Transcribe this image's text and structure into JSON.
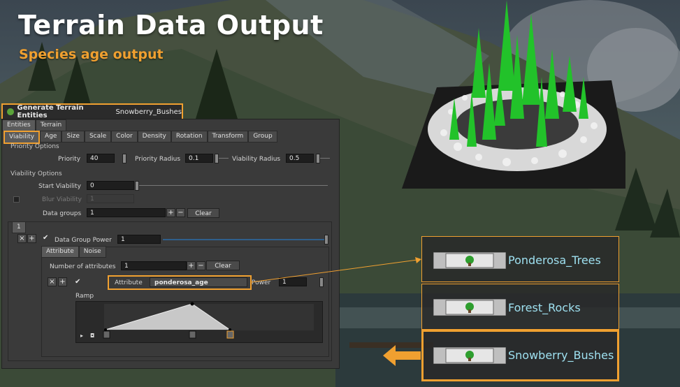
{
  "slide": {
    "title": "Terrain Data Output",
    "subtitle": "Species age output"
  },
  "header": {
    "title": "Generate Terrain Entities",
    "node_name": "Snowberry_Bushes"
  },
  "top_tabs": [
    "Entities",
    "Terrain"
  ],
  "tabs": [
    "Viability",
    "Age",
    "Size",
    "Scale",
    "Color",
    "Density",
    "Rotation",
    "Transform",
    "Group"
  ],
  "priority": {
    "section": "Priority Options",
    "priority_label": "Priority",
    "priority_value": "40",
    "radius_label": "Priority Radius",
    "radius_value": "0.1",
    "viability_radius_label": "Viability Radius",
    "viability_radius_value": "0.5"
  },
  "viability": {
    "section": "Viability Options",
    "start_label": "Start Viability",
    "start_value": "0",
    "blur_label": "Blur Viability",
    "blur_value": "1",
    "groups_label": "Data groups",
    "groups_value": "1",
    "clear": "Clear",
    "group_index": "1"
  },
  "data_group": {
    "power_label": "Data Group Power",
    "power_value": "1",
    "subtabs": [
      "Attribute",
      "Noise"
    ],
    "num_attr_label": "Number of attributes",
    "num_attr_value": "1",
    "clear": "Clear",
    "attribute_label": "Attribute",
    "attribute_value": "ponderosa_age",
    "attr_power_label": "Power",
    "attr_power_value": "1",
    "ramp_label": "Ramp"
  },
  "nodes": [
    {
      "label": "Ponderosa_Trees"
    },
    {
      "label": "Forest_Rocks"
    },
    {
      "label": "Snowberry_Bushes"
    }
  ],
  "colors": {
    "accent": "#f0a030",
    "node_text": "#9ee0f0",
    "tree": "#22c22a"
  }
}
